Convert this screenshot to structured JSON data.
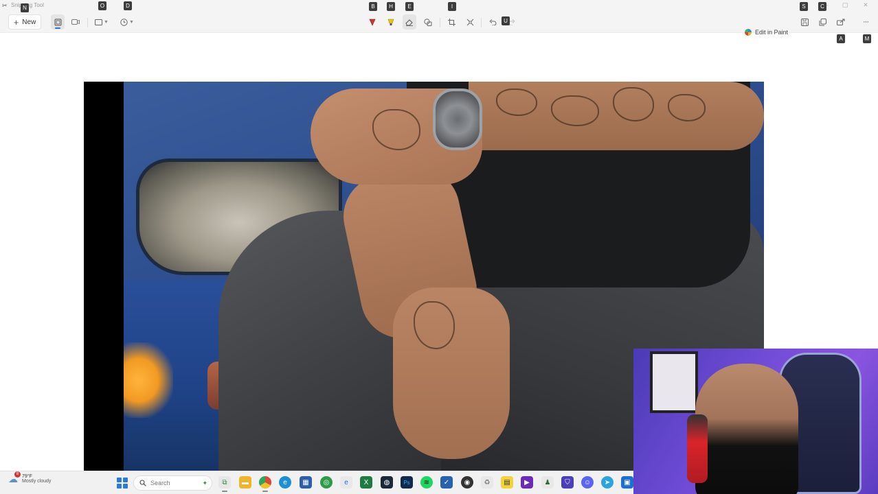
{
  "window": {
    "title": "Snipping Tool",
    "title_icon": "scissors-icon",
    "minimize_glyph": "–",
    "maximize_glyph": "▢",
    "close_glyph": "✕"
  },
  "toolbar": {
    "new_label": "New",
    "edit_in_paint_label": "Edit in Paint",
    "more_glyph": "···"
  },
  "keytips": {
    "new": "N",
    "snip_shape": "O",
    "delay": "D",
    "ballpoint": "B",
    "highlighter": "H",
    "eraser": "E",
    "ruler": "I",
    "undo": "U",
    "save": "S",
    "copy": "C",
    "share": "A",
    "more": "M"
  },
  "taskbar": {
    "weather_badge": "8",
    "weather_temp": "79°F",
    "weather_desc": "Mostly cloudy",
    "search_placeholder": "Search"
  },
  "colors": {
    "accent": "#2a6fd6",
    "ballpoint_red": "#d4342f",
    "highlighter_yellow": "#e8c21a",
    "keytip_bg": "#3c3c3c"
  }
}
